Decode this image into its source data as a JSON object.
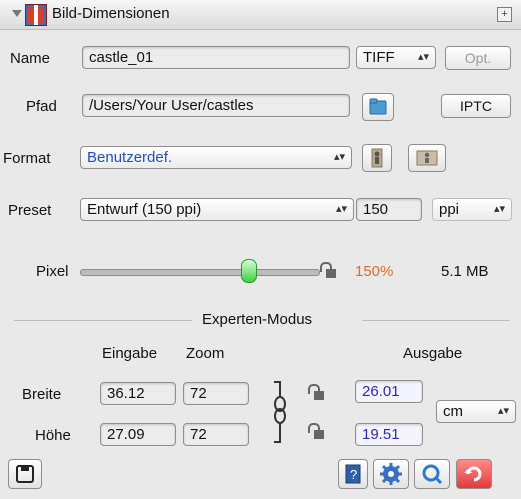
{
  "window": {
    "title": "Bild-Dimensionen"
  },
  "row_name": {
    "label": "Name",
    "value": "castle_01",
    "filetype": "TIFF",
    "opt_label": "Opt."
  },
  "row_path": {
    "label": "Pfad",
    "value": "/Users/Your User/castles",
    "iptc_label": "IPTC"
  },
  "row_format": {
    "label": "Format",
    "value": "Benutzerdef."
  },
  "row_preset": {
    "label": "Preset",
    "value": "Entwurf (150 ppi)",
    "resolution": "150",
    "unit": "ppi"
  },
  "row_pixel": {
    "label": "Pixel",
    "percent": "150%",
    "size": "5.1 MB"
  },
  "expert": {
    "title": "Experten-Modus",
    "col_input": "Eingabe",
    "col_zoom": "Zoom",
    "col_output": "Ausgabe",
    "width_label": "Breite",
    "height_label": "Höhe",
    "width_input": "36.12",
    "width_zoom": "72",
    "width_output": "26.01",
    "height_input": "27.09",
    "height_zoom": "72",
    "height_output": "19.51",
    "unit": "cm"
  },
  "colors": {
    "percent": "#e06a2a",
    "output_text": "#2a2ab0",
    "accent_blue": "#1f4fbf"
  }
}
